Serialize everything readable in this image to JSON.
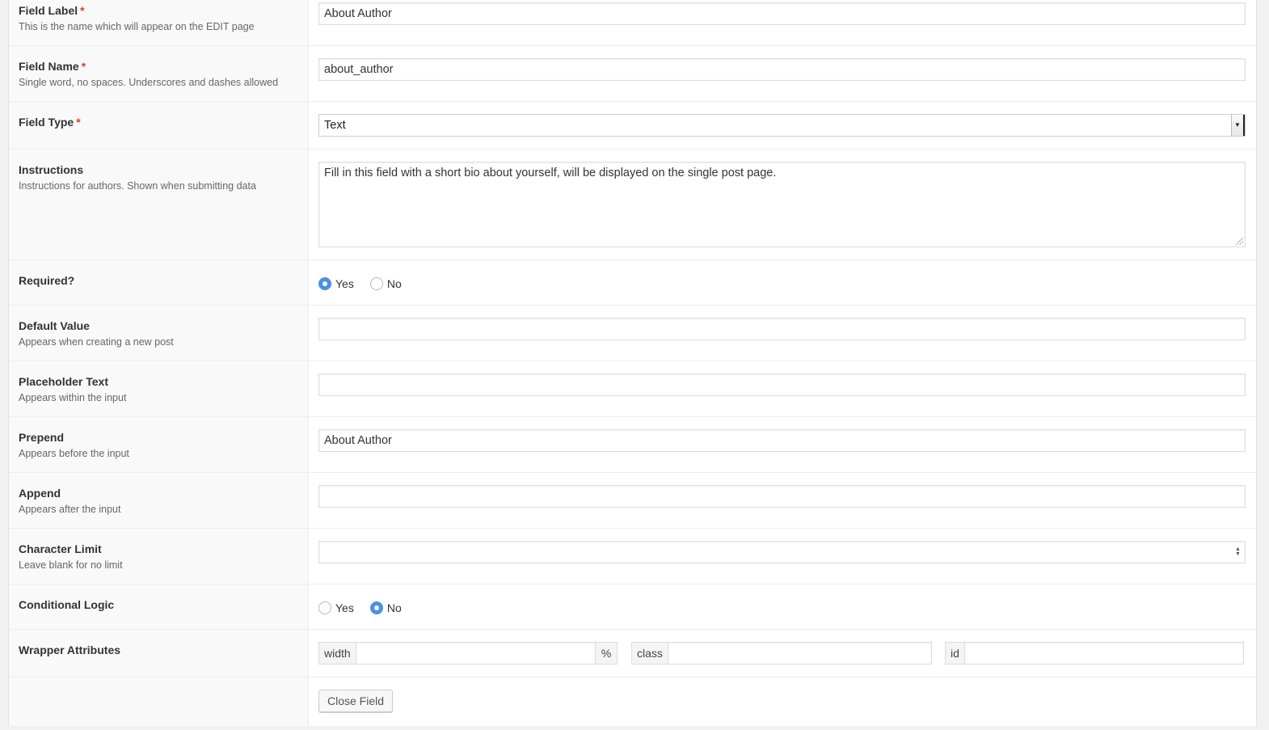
{
  "required_marker": "*",
  "fields": {
    "field_label": {
      "title": "Field Label",
      "desc": "This is the name which will appear on the EDIT page",
      "value": "About Author"
    },
    "field_name": {
      "title": "Field Name",
      "desc": "Single word, no spaces. Underscores and dashes allowed",
      "value": "about_author"
    },
    "field_type": {
      "title": "Field Type",
      "selected": "Text"
    },
    "instructions": {
      "title": "Instructions",
      "desc": "Instructions for authors. Shown when submitting data",
      "value": "Fill in this field with a short bio about yourself, will be displayed on the single post page."
    },
    "required": {
      "title": "Required?",
      "options": [
        "Yes",
        "No"
      ],
      "selected": "Yes"
    },
    "default_value": {
      "title": "Default Value",
      "desc": "Appears when creating a new post",
      "value": ""
    },
    "placeholder_text": {
      "title": "Placeholder Text",
      "desc": "Appears within the input",
      "value": ""
    },
    "prepend": {
      "title": "Prepend",
      "desc": "Appears before the input",
      "value": "About Author"
    },
    "append": {
      "title": "Append",
      "desc": "Appears after the input",
      "value": ""
    },
    "character_limit": {
      "title": "Character Limit",
      "desc": "Leave blank for no limit",
      "value": ""
    },
    "conditional_logic": {
      "title": "Conditional Logic",
      "options": [
        "Yes",
        "No"
      ],
      "selected": "No"
    },
    "wrapper_attributes": {
      "title": "Wrapper Attributes",
      "width_label": "width",
      "width_suffix": "%",
      "class_label": "class",
      "id_label": "id",
      "width_value": "",
      "class_value": "",
      "id_value": ""
    }
  },
  "close_button": "Close Field",
  "colors": {
    "required_marker": "#dd3d36",
    "radio_checked": "#4a90e2"
  }
}
